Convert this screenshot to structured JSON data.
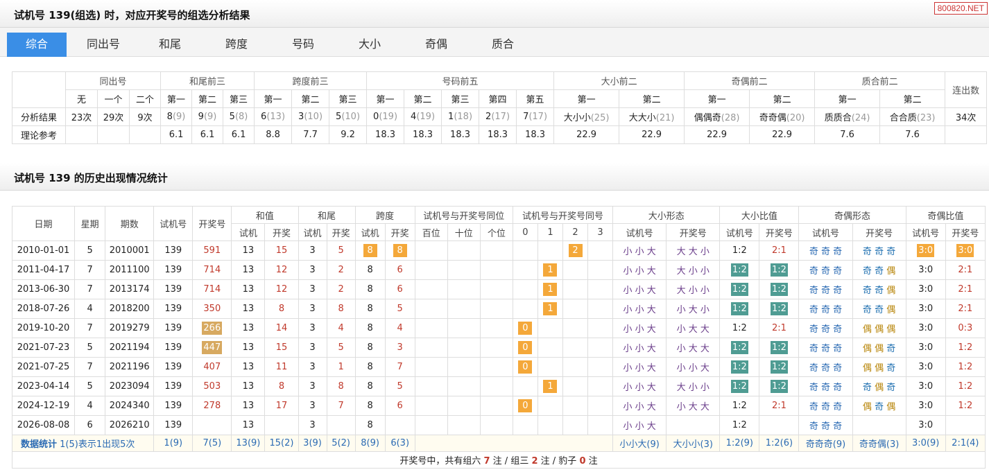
{
  "header1": {
    "title": "试机号 139(组选) 时，对应开奖号的组选分析结果",
    "logo": "800820.NET"
  },
  "tabs": [
    "综合",
    "同出号",
    "和尾",
    "跨度",
    "号码",
    "大小",
    "奇偶",
    "质合"
  ],
  "summary": {
    "groups": [
      "同出号",
      "和尾前三",
      "跨度前三",
      "号码前五",
      "大小前二",
      "奇偶前二",
      "质合前二",
      "连出数"
    ],
    "subs": [
      "无",
      "一个",
      "二个",
      "第一",
      "第二",
      "第三",
      "第一",
      "第二",
      "第三",
      "第一",
      "第二",
      "第三",
      "第四",
      "第五",
      "第一",
      "第二",
      "第一",
      "第二",
      "第一",
      "第二"
    ],
    "row1_label": "分析结果",
    "row1": [
      [
        "23次",
        ""
      ],
      [
        "29次",
        ""
      ],
      [
        "9次",
        ""
      ],
      [
        "8",
        "(9)"
      ],
      [
        "9",
        "(9)"
      ],
      [
        "5",
        "(8)"
      ],
      [
        "6",
        "(13)"
      ],
      [
        "3",
        "(10)"
      ],
      [
        "5",
        "(10)"
      ],
      [
        "0",
        "(19)"
      ],
      [
        "4",
        "(19)"
      ],
      [
        "1",
        "(18)"
      ],
      [
        "2",
        "(17)"
      ],
      [
        "7",
        "(17)"
      ],
      [
        "大小小",
        "(25)"
      ],
      [
        "大大小",
        "(21)"
      ],
      [
        "偶偶奇",
        "(28)"
      ],
      [
        "奇奇偶",
        "(20)"
      ],
      [
        "质质合",
        "(24)"
      ],
      [
        "合合质",
        "(23)"
      ],
      [
        "34次",
        ""
      ]
    ],
    "row2_label": "理论参考",
    "row2": [
      "",
      "",
      "",
      "6.1",
      "6.1",
      "6.1",
      "8.8",
      "7.7",
      "9.2",
      "18.3",
      "18.3",
      "18.3",
      "18.3",
      "18.3",
      "22.9",
      "22.9",
      "22.9",
      "22.9",
      "7.6",
      "7.6",
      ""
    ]
  },
  "header2": {
    "title": "试机号 139 的历史出现情况统计"
  },
  "history": {
    "h1": [
      "日期",
      "星期",
      "期数",
      "试机号",
      "开奖号",
      "和值",
      "和尾",
      "跨度",
      "试机号与开奖号同位",
      "试机号与开奖号同号",
      "大小形态",
      "大小比值",
      "奇偶形态",
      "奇偶比值"
    ],
    "h2": [
      "试机",
      "开奖",
      "试机",
      "开奖",
      "试机",
      "开奖",
      "百位",
      "十位",
      "个位",
      "0",
      "1",
      "2",
      "3",
      "试机号",
      "开奖号",
      "试机号",
      "开奖号",
      "试机号",
      "开奖号",
      "试机号",
      "开奖号"
    ],
    "rows": [
      {
        "date": "2010-01-01",
        "week": "5",
        "issue": "2010001",
        "sj": "139",
        "kj": "591",
        "kjTag": "",
        "hs": "13",
        "hk": "15",
        "ws": "3",
        "wk": "5",
        "ks": "8",
        "kk": "8",
        "ksTag": "or",
        "kkTag": "or",
        "same": "2",
        "sameCol": 2,
        "dxs": "小 小 大",
        "dxk": "大 大 小",
        "dbs": "1:2",
        "dbk": "2:1",
        "dbsTag": "",
        "dbkTag": "",
        "jos": "奇 奇 奇",
        "jok": "奇 奇 奇",
        "jbs": "3:0",
        "jbk": "3:0",
        "jbsTag": "or",
        "jbkTag": "or"
      },
      {
        "date": "2011-04-17",
        "week": "7",
        "issue": "2011100",
        "sj": "139",
        "kj": "714",
        "kjTag": "",
        "hs": "13",
        "hk": "12",
        "ws": "3",
        "wk": "2",
        "ks": "8",
        "kk": "6",
        "ksTag": "",
        "kkTag": "",
        "same": "1",
        "sameCol": 1,
        "dxs": "小 小 大",
        "dxk": "大 小 小",
        "dbs": "1:2",
        "dbk": "1:2",
        "dbsTag": "te",
        "dbkTag": "te",
        "jos": "奇 奇 奇",
        "jok": "奇 奇 偶",
        "jbs": "3:0",
        "jbk": "2:1",
        "jbsTag": "",
        "jbkTag": ""
      },
      {
        "date": "2013-06-30",
        "week": "7",
        "issue": "2013174",
        "sj": "139",
        "kj": "714",
        "kjTag": "",
        "hs": "13",
        "hk": "12",
        "ws": "3",
        "wk": "2",
        "ks": "8",
        "kk": "6",
        "ksTag": "",
        "kkTag": "",
        "same": "1",
        "sameCol": 1,
        "dxs": "小 小 大",
        "dxk": "大 小 小",
        "dbs": "1:2",
        "dbk": "1:2",
        "dbsTag": "te",
        "dbkTag": "te",
        "jos": "奇 奇 奇",
        "jok": "奇 奇 偶",
        "jbs": "3:0",
        "jbk": "2:1",
        "jbsTag": "",
        "jbkTag": ""
      },
      {
        "date": "2018-07-26",
        "week": "4",
        "issue": "2018200",
        "sj": "139",
        "kj": "350",
        "kjTag": "",
        "hs": "13",
        "hk": "8",
        "ws": "3",
        "wk": "8",
        "ks": "8",
        "kk": "5",
        "ksTag": "",
        "kkTag": "",
        "same": "1",
        "sameCol": 1,
        "dxs": "小 小 大",
        "dxk": "小 大 小",
        "dbs": "1:2",
        "dbk": "1:2",
        "dbsTag": "te",
        "dbkTag": "te",
        "jos": "奇 奇 奇",
        "jok": "奇 奇 偶",
        "jbs": "3:0",
        "jbk": "2:1",
        "jbsTag": "",
        "jbkTag": ""
      },
      {
        "date": "2019-10-20",
        "week": "7",
        "issue": "2019279",
        "sj": "139",
        "kj": "266",
        "kjTag": "tn",
        "hs": "13",
        "hk": "14",
        "ws": "3",
        "wk": "4",
        "ks": "8",
        "kk": "4",
        "ksTag": "",
        "kkTag": "",
        "same": "0",
        "sameCol": 0,
        "dxs": "小 小 大",
        "dxk": "小 大 大",
        "dbs": "1:2",
        "dbk": "2:1",
        "dbsTag": "",
        "dbkTag": "",
        "jos": "奇 奇 奇",
        "jok": "偶 偶 偶",
        "jbs": "3:0",
        "jbk": "0:3",
        "jbsTag": "",
        "jbkTag": ""
      },
      {
        "date": "2021-07-23",
        "week": "5",
        "issue": "2021194",
        "sj": "139",
        "kj": "447",
        "kjTag": "tn",
        "hs": "13",
        "hk": "15",
        "ws": "3",
        "wk": "5",
        "ks": "8",
        "kk": "3",
        "ksTag": "",
        "kkTag": "",
        "same": "0",
        "sameCol": 0,
        "dxs": "小 小 大",
        "dxk": "小 大 大",
        "dbs": "1:2",
        "dbk": "1:2",
        "dbsTag": "te",
        "dbkTag": "te",
        "jos": "奇 奇 奇",
        "jok": "偶 偶 奇",
        "jbs": "3:0",
        "jbk": "1:2",
        "jbsTag": "",
        "jbkTag": ""
      },
      {
        "date": "2021-07-25",
        "week": "7",
        "issue": "2021196",
        "sj": "139",
        "kj": "407",
        "kjTag": "",
        "hs": "13",
        "hk": "11",
        "ws": "3",
        "wk": "1",
        "ks": "8",
        "kk": "7",
        "ksTag": "",
        "kkTag": "",
        "same": "0",
        "sameCol": 0,
        "dxs": "小 小 大",
        "dxk": "小 小 大",
        "dbs": "1:2",
        "dbk": "1:2",
        "dbsTag": "te",
        "dbkTag": "te",
        "jos": "奇 奇 奇",
        "jok": "偶 偶 奇",
        "jbs": "3:0",
        "jbk": "1:2",
        "jbsTag": "",
        "jbkTag": ""
      },
      {
        "date": "2023-04-14",
        "week": "5",
        "issue": "2023094",
        "sj": "139",
        "kj": "503",
        "kjTag": "",
        "hs": "13",
        "hk": "8",
        "ws": "3",
        "wk": "8",
        "ks": "8",
        "kk": "5",
        "ksTag": "",
        "kkTag": "",
        "same": "1",
        "sameCol": 1,
        "dxs": "小 小 大",
        "dxk": "大 小 小",
        "dbs": "1:2",
        "dbk": "1:2",
        "dbsTag": "te",
        "dbkTag": "te",
        "jos": "奇 奇 奇",
        "jok": "奇 偶 奇",
        "jbs": "3:0",
        "jbk": "1:2",
        "jbsTag": "",
        "jbkTag": ""
      },
      {
        "date": "2024-12-19",
        "week": "4",
        "issue": "2024340",
        "sj": "139",
        "kj": "278",
        "kjTag": "",
        "hs": "13",
        "hk": "17",
        "ws": "3",
        "wk": "7",
        "ks": "8",
        "kk": "6",
        "ksTag": "",
        "kkTag": "",
        "same": "0",
        "sameCol": 0,
        "dxs": "小 小 大",
        "dxk": "小 大 大",
        "dbs": "1:2",
        "dbk": "2:1",
        "dbsTag": "",
        "dbkTag": "",
        "jos": "奇 奇 奇",
        "jok": "偶 奇 偶",
        "jbs": "3:0",
        "jbk": "1:2",
        "jbsTag": "",
        "jbkTag": ""
      },
      {
        "date": "2026-08-08",
        "week": "6",
        "issue": "2026210",
        "sj": "139",
        "kj": "",
        "kjTag": "",
        "hs": "13",
        "hk": "",
        "ws": "3",
        "wk": "",
        "ks": "8",
        "kk": "",
        "ksTag": "",
        "kkTag": "",
        "same": "",
        "sameCol": -1,
        "dxs": "小 小 大",
        "dxk": "",
        "dbs": "1:2",
        "dbk": "",
        "dbsTag": "",
        "dbkTag": "",
        "jos": "奇 奇 奇",
        "jok": "",
        "jbs": "3:0",
        "jbk": "",
        "jbsTag": "",
        "jbkTag": ""
      }
    ],
    "stats": {
      "label": "数据统计",
      "note": "1(5)表示1出现5次",
      "sj": "1(9)",
      "kj": "7(5)",
      "hs": "13(9)",
      "hk": "15(2)",
      "ws": "3(9)",
      "wk": "5(2)",
      "ks": "8(9)",
      "kk": "6(3)",
      "dxs": "小小大(9)",
      "dxk": "大小小(3)",
      "dbs": "1:2(9)",
      "dbk": "1:2(6)",
      "jos": "奇奇奇(9)",
      "jok": "奇奇偶(3)",
      "jbs": "3:0(9)",
      "jbk": "2:1(4)"
    },
    "footer": {
      "a": "开奖号中，共有组六",
      "n1": "7",
      "b": "注 / 组三",
      "n2": "2",
      "c": "注 / 豹子",
      "n3": "0",
      "d": "注"
    }
  }
}
